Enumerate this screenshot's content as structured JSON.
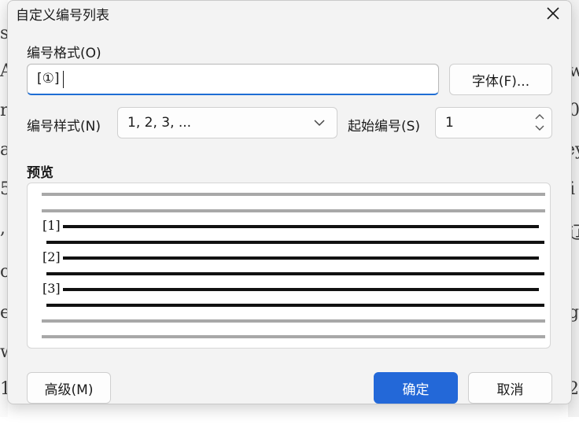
{
  "dialog": {
    "title": "自定义编号列表",
    "format_label": "编号格式(O)",
    "format_value": "[①]",
    "font_button": "字体(F)...",
    "style_label": "编号样式(N)",
    "style_value": "1, 2, 3, ...",
    "start_label": "起始编号(S)",
    "start_value": "1",
    "preview_label": "预览",
    "preview_items": [
      "[1]",
      "[2]",
      "[3]"
    ],
    "advanced_button": "高级(M)",
    "ok_button": "确定",
    "cancel_button": "取消",
    "colors": {
      "primary": "#2368d8",
      "focus": "#1f6ed4"
    }
  },
  "background": {
    "glyphs": [
      "s:",
      "A",
      "ra",
      "a",
      "5",
      ",",
      "o:",
      "e",
      "w",
      "1",
      "w",
      "0",
      "ey",
      "i",
      "辽",
      "g",
      "2"
    ]
  }
}
